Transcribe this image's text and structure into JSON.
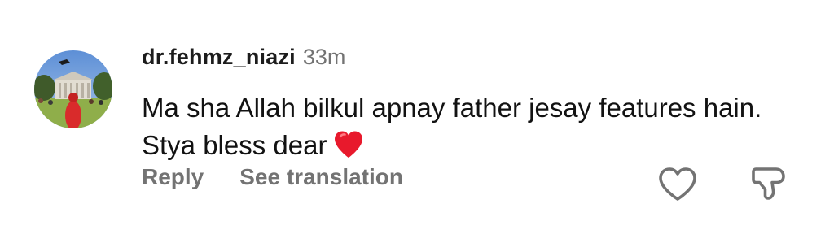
{
  "comment": {
    "username": "dr.fehmz_niazi",
    "time": "33m",
    "text": "Ma sha Allah bilkul apnay father jesay features hain. Stya bless dear",
    "emoji": "red-heart-emoji"
  },
  "actions": {
    "reply_label": "Reply",
    "translate_label": "See translation"
  },
  "icons": {
    "like": "heart-outline-icon",
    "dislike": "thumbs-down-outline-icon"
  },
  "colors": {
    "username": "#1c1c1c",
    "secondary_text": "#737373",
    "body_text": "#121212",
    "heart_emoji": "#e8192c"
  }
}
